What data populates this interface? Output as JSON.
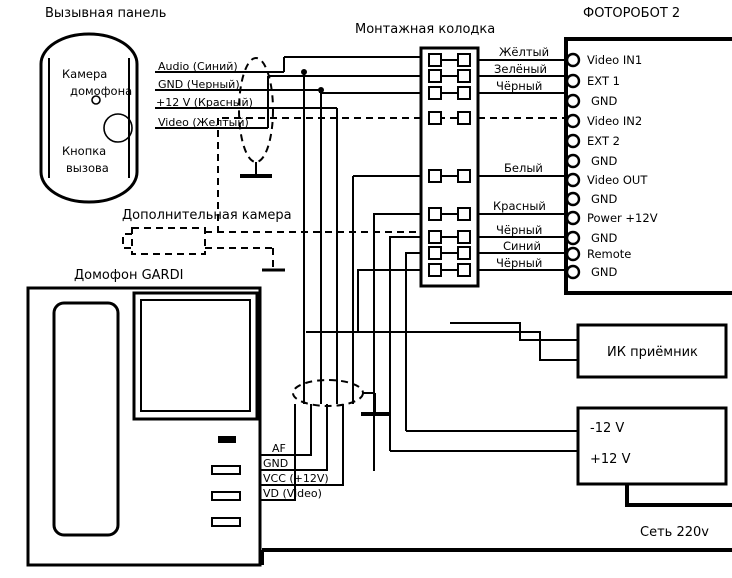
{
  "diagram": {
    "title_call_panel": "Вызывная панель",
    "title_terminal_block": "Монтажная колодка",
    "title_device": "ФОТОРОБОТ 2",
    "title_extra_camera": "Дополнительная камера",
    "title_monitor": "Домофон GARDI",
    "ir_receiver": "ИК приёмник",
    "mains": "Сеть 220v",
    "colors": {
      "line": "#000000",
      "background": "#ffffff"
    }
  },
  "call_panel": {
    "camera_label_line1": "Камера",
    "camera_label_line2": "домофона",
    "button_label_line1": "Кнопка",
    "button_label_line2": "вызова",
    "wires": [
      {
        "label": "Audio (Синий)"
      },
      {
        "label": "GND (Черный)"
      },
      {
        "label": "+12 V (Красный)"
      },
      {
        "label": "Video (Желтый)"
      }
    ]
  },
  "monitor": {
    "terminals": [
      {
        "label": "AF"
      },
      {
        "label": "GND"
      },
      {
        "label": "VCC (+12V)"
      },
      {
        "label": "VD (Video)"
      }
    ]
  },
  "wire_colors_right": [
    {
      "label": "Жёлтый"
    },
    {
      "label": "Зелёный"
    },
    {
      "label": "Чёрный"
    },
    {
      "label": "Белый"
    },
    {
      "label": "Красный"
    },
    {
      "label": "Чёрный"
    },
    {
      "label": "Синий"
    },
    {
      "label": "Чёрный"
    }
  ],
  "device_pins": [
    {
      "label": "Video IN1"
    },
    {
      "label": "EXT 1"
    },
    {
      "label": "GND"
    },
    {
      "label": "Video IN2"
    },
    {
      "label": "EXT 2"
    },
    {
      "label": "GND"
    },
    {
      "label": "Video OUT"
    },
    {
      "label": "GND"
    },
    {
      "label": "Power +12V"
    },
    {
      "label": "GND"
    },
    {
      "label": "Remote"
    },
    {
      "label": "GND"
    }
  ],
  "power_supply": {
    "out_negative": "-12 V",
    "out_positive": "+12 V"
  }
}
